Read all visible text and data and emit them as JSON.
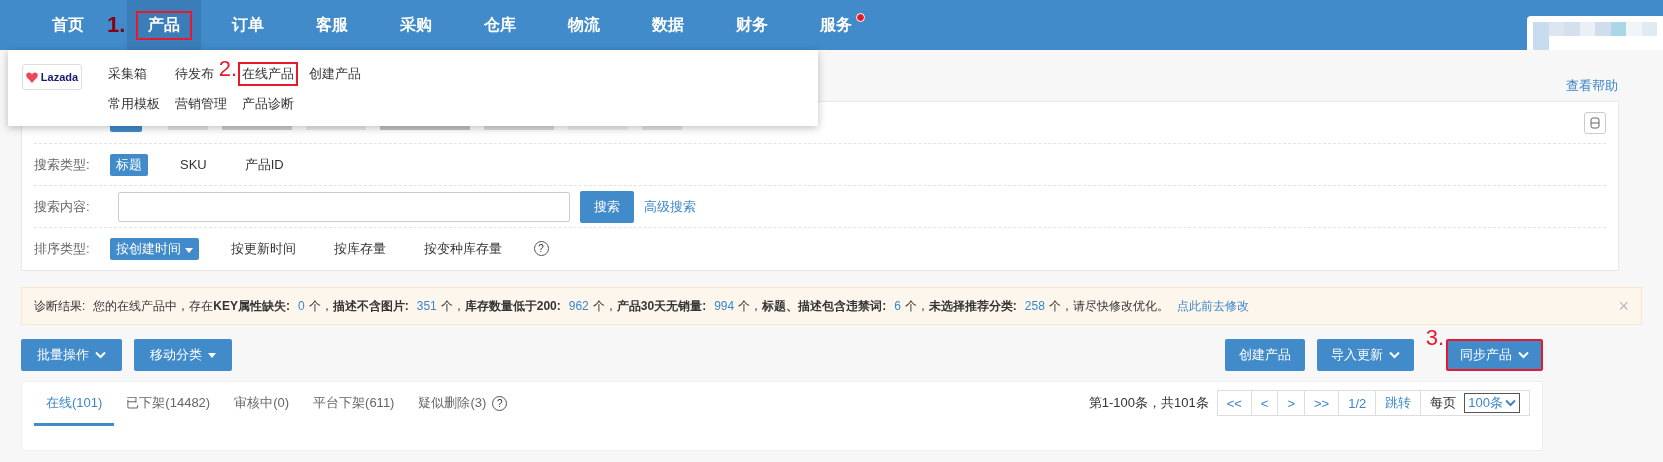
{
  "nav": {
    "items": [
      {
        "label": "首页",
        "selected": false,
        "highlighted": false,
        "badge": false
      },
      {
        "label": "产品",
        "selected": true,
        "highlighted": true,
        "annotation": "1.",
        "badge": false
      },
      {
        "label": "订单",
        "selected": false,
        "highlighted": false,
        "badge": false
      },
      {
        "label": "客服",
        "selected": false,
        "highlighted": false,
        "badge": false
      },
      {
        "label": "采购",
        "selected": false,
        "highlighted": false,
        "badge": false
      },
      {
        "label": "仓库",
        "selected": false,
        "highlighted": false,
        "badge": false
      },
      {
        "label": "物流",
        "selected": false,
        "highlighted": false,
        "badge": false
      },
      {
        "label": "数据",
        "selected": false,
        "highlighted": false,
        "badge": false
      },
      {
        "label": "财务",
        "selected": false,
        "highlighted": false,
        "badge": false
      },
      {
        "label": "服务",
        "selected": false,
        "highlighted": false,
        "badge": true
      }
    ]
  },
  "menu": {
    "brand": "Lazada",
    "rows": [
      [
        {
          "label": "采集箱",
          "highlighted": false
        },
        {
          "label": "待发布",
          "highlighted": false
        },
        {
          "label": "在线产品",
          "highlighted": true,
          "annotation": "2."
        },
        {
          "label": "创建产品",
          "highlighted": false
        }
      ],
      [
        {
          "label": "常用模板",
          "highlighted": false
        },
        {
          "label": "营销管理",
          "highlighted": false
        },
        {
          "label": "产品诊断",
          "highlighted": false
        }
      ]
    ]
  },
  "help_link": "查看帮助",
  "filters": {
    "account": {
      "options": [
        {
          "selected": true
        }
      ]
    },
    "search_type": {
      "label": "搜索类型:",
      "options": [
        {
          "label": "标题",
          "selected": true
        },
        {
          "label": "SKU",
          "selected": false
        },
        {
          "label": "产品ID",
          "selected": false
        }
      ]
    },
    "search_content": {
      "label": "搜索内容:",
      "button": "搜索",
      "link": "高级搜索"
    },
    "sort": {
      "label": "排序类型:",
      "options": [
        {
          "label": "按创建时间",
          "selected": true
        },
        {
          "label": "按更新时间",
          "selected": false
        },
        {
          "label": "按库存量",
          "selected": false
        },
        {
          "label": "按变种库存量",
          "selected": false
        }
      ],
      "help_icon": "?"
    }
  },
  "diagnosis": {
    "label": "诊断结果:",
    "parts": [
      {
        "kind": "plain",
        "text": "您的在线产品中，存在"
      },
      {
        "kind": "label",
        "text": "KEY属性缺失:"
      },
      {
        "kind": "count",
        "text": "0"
      },
      {
        "kind": "plain",
        "text": "个，"
      },
      {
        "kind": "label",
        "text": "描述不含图片:"
      },
      {
        "kind": "count",
        "text": "351"
      },
      {
        "kind": "plain",
        "text": "个，"
      },
      {
        "kind": "label",
        "text": "库存数量低于200:"
      },
      {
        "kind": "count",
        "text": "962"
      },
      {
        "kind": "plain",
        "text": "个，"
      },
      {
        "kind": "label",
        "text": "产品30天无销量:"
      },
      {
        "kind": "count",
        "text": "994"
      },
      {
        "kind": "plain",
        "text": "个，"
      },
      {
        "kind": "label",
        "text": "标题、描述包含违禁词:"
      },
      {
        "kind": "count",
        "text": "6"
      },
      {
        "kind": "plain",
        "text": "个，"
      },
      {
        "kind": "label",
        "text": "未选择推荐分类:"
      },
      {
        "kind": "count",
        "text": "258"
      },
      {
        "kind": "plain",
        "text": "个，"
      },
      {
        "kind": "plain",
        "text": "请尽快修改优化。"
      }
    ],
    "link": "点此前去修改",
    "close": "×"
  },
  "actions": {
    "left": [
      {
        "label": "批量操作",
        "kind": "chevron",
        "highlighted": false
      },
      {
        "label": "移动分类",
        "kind": "caret",
        "highlighted": false
      }
    ],
    "right": [
      {
        "label": "创建产品",
        "kind": "plain",
        "highlighted": false
      },
      {
        "label": "导入更新",
        "kind": "chevron",
        "highlighted": false
      },
      {
        "label": "同步产品",
        "kind": "chevron",
        "highlighted": true,
        "annotation": "3."
      }
    ]
  },
  "tabs": [
    {
      "label": "在线(101)",
      "selected": true
    },
    {
      "label": "已下架(14482)",
      "selected": false
    },
    {
      "label": "审核中(0)",
      "selected": false
    },
    {
      "label": "平台下架(611)",
      "selected": false
    },
    {
      "label": "疑似删除(3)",
      "selected": false
    }
  ],
  "tabs_help_icon": "?",
  "pagination": {
    "summary": "第1-100条，共101条",
    "buttons": [
      "<<",
      "<",
      ">",
      ">>",
      "1/2",
      "跳转"
    ],
    "per_page_label": "每页",
    "per_page": "100条"
  }
}
